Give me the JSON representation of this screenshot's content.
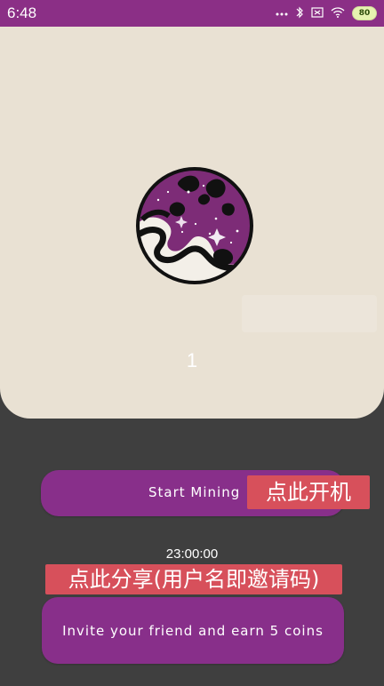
{
  "status_bar": {
    "time": "6:48",
    "battery": "80",
    "icons": [
      "more-icon",
      "bluetooth-icon",
      "sim-icon",
      "wifi-icon",
      "battery-icon"
    ]
  },
  "hero": {
    "icon": "planet-icon",
    "counter": "1"
  },
  "actions": {
    "start_label": "Start Mining",
    "start_overlay": "点此开机",
    "timer": "23:00:00",
    "share_overlay": "点此分享(用户名即邀请码)",
    "invite_label": "Invite your friend and earn 5 coins"
  },
  "colors": {
    "primary": "#882f8a",
    "status_bar": "#8b2f86",
    "card_bg": "#e9e1d3",
    "screen_bg": "#3f3f3f",
    "overlay_red": "#d7505b"
  }
}
